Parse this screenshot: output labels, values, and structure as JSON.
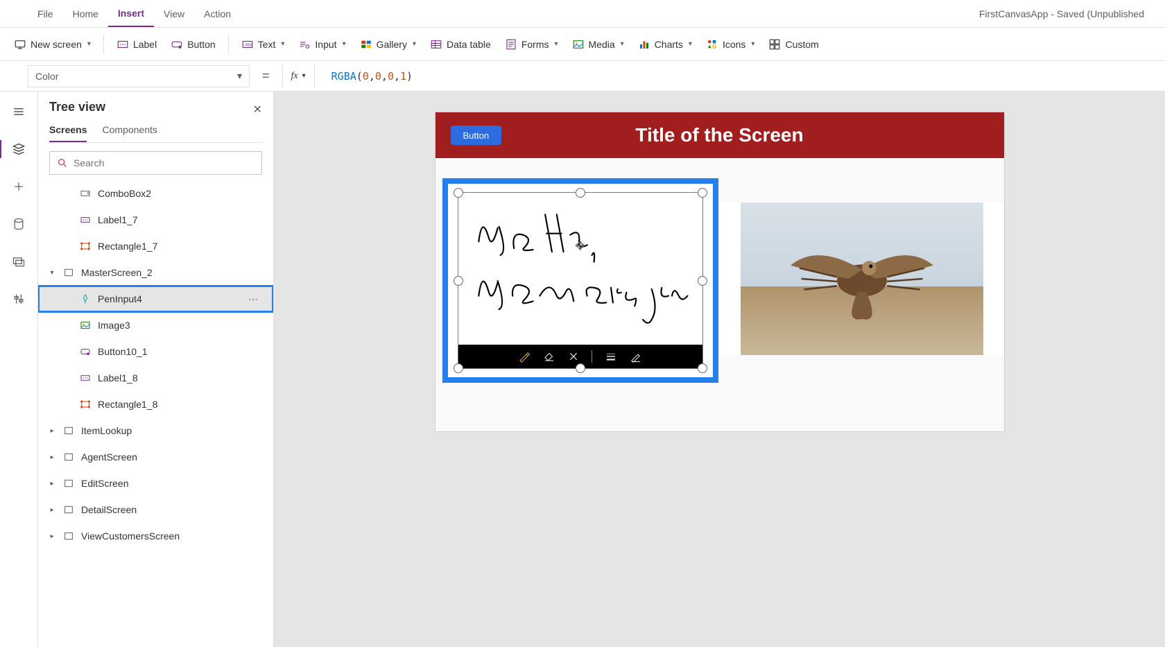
{
  "topMenu": {
    "items": [
      "File",
      "Home",
      "Insert",
      "View",
      "Action"
    ],
    "activeIndex": 2,
    "appTitle": "FirstCanvasApp - Saved (Unpublished"
  },
  "ribbon": {
    "newScreen": "New screen",
    "label": "Label",
    "button": "Button",
    "text": "Text",
    "input": "Input",
    "gallery": "Gallery",
    "dataTable": "Data table",
    "forms": "Forms",
    "media": "Media",
    "charts": "Charts",
    "icons": "Icons",
    "custom": "Custom"
  },
  "formulaBar": {
    "property": "Color",
    "fx": "fx",
    "fn": "RGBA",
    "args": [
      "0",
      "0",
      "0",
      "1"
    ]
  },
  "treePanel": {
    "title": "Tree view",
    "tabs": {
      "screens": "Screens",
      "components": "Components"
    },
    "searchPlaceholder": "Search",
    "items": [
      {
        "label": "ComboBox2",
        "icon": "combobox",
        "level": 1
      },
      {
        "label": "Label1_7",
        "icon": "label",
        "level": 1
      },
      {
        "label": "Rectangle1_7",
        "icon": "rectangle",
        "level": 1
      },
      {
        "label": "MasterScreen_2",
        "icon": "screen",
        "level": 0,
        "chev": "down"
      },
      {
        "label": "PenInput4",
        "icon": "pen",
        "level": 1,
        "selected": true
      },
      {
        "label": "Image3",
        "icon": "image",
        "level": 1
      },
      {
        "label": "Button10_1",
        "icon": "button",
        "level": 1
      },
      {
        "label": "Label1_8",
        "icon": "label",
        "level": 1
      },
      {
        "label": "Rectangle1_8",
        "icon": "rectangle",
        "level": 1
      },
      {
        "label": "ItemLookup",
        "icon": "screen",
        "level": 0,
        "chev": "right"
      },
      {
        "label": "AgentScreen",
        "icon": "screen",
        "level": 0,
        "chev": "right"
      },
      {
        "label": "EditScreen",
        "icon": "screen",
        "level": 0,
        "chev": "right"
      },
      {
        "label": "DetailScreen",
        "icon": "screen",
        "level": 0,
        "chev": "right"
      },
      {
        "label": "ViewCustomersScreen",
        "icon": "screen",
        "level": 0,
        "chev": "right"
      }
    ]
  },
  "canvas": {
    "buttonLabel": "Button",
    "titleLabel": "Title of the Screen",
    "penText1": "Hello,",
    "penText2": "How are you"
  }
}
